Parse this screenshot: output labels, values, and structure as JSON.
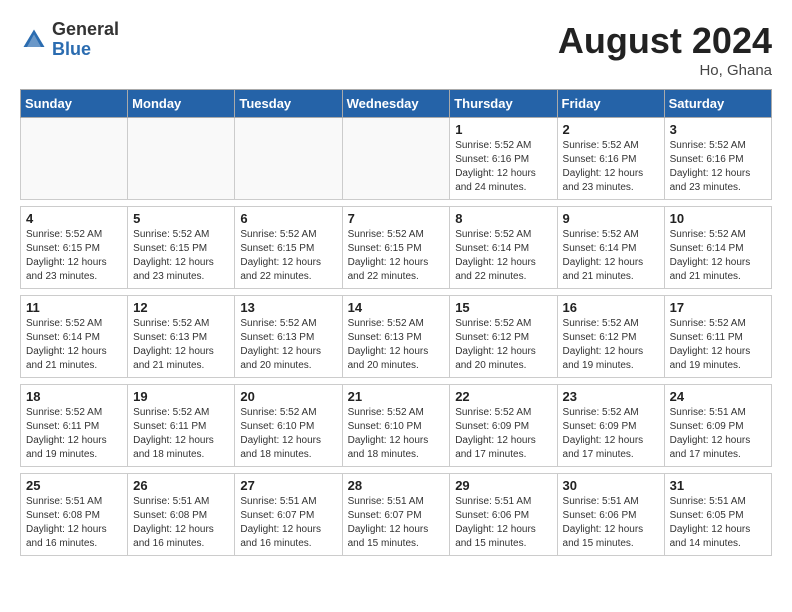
{
  "logo": {
    "general": "General",
    "blue": "Blue"
  },
  "title": {
    "month_year": "August 2024",
    "location": "Ho, Ghana"
  },
  "headers": [
    "Sunday",
    "Monday",
    "Tuesday",
    "Wednesday",
    "Thursday",
    "Friday",
    "Saturday"
  ],
  "weeks": [
    [
      {
        "day": "",
        "info": ""
      },
      {
        "day": "",
        "info": ""
      },
      {
        "day": "",
        "info": ""
      },
      {
        "day": "",
        "info": ""
      },
      {
        "day": "1",
        "info": "Sunrise: 5:52 AM\nSunset: 6:16 PM\nDaylight: 12 hours\nand 24 minutes."
      },
      {
        "day": "2",
        "info": "Sunrise: 5:52 AM\nSunset: 6:16 PM\nDaylight: 12 hours\nand 23 minutes."
      },
      {
        "day": "3",
        "info": "Sunrise: 5:52 AM\nSunset: 6:16 PM\nDaylight: 12 hours\nand 23 minutes."
      }
    ],
    [
      {
        "day": "4",
        "info": "Sunrise: 5:52 AM\nSunset: 6:15 PM\nDaylight: 12 hours\nand 23 minutes."
      },
      {
        "day": "5",
        "info": "Sunrise: 5:52 AM\nSunset: 6:15 PM\nDaylight: 12 hours\nand 23 minutes."
      },
      {
        "day": "6",
        "info": "Sunrise: 5:52 AM\nSunset: 6:15 PM\nDaylight: 12 hours\nand 22 minutes."
      },
      {
        "day": "7",
        "info": "Sunrise: 5:52 AM\nSunset: 6:15 PM\nDaylight: 12 hours\nand 22 minutes."
      },
      {
        "day": "8",
        "info": "Sunrise: 5:52 AM\nSunset: 6:14 PM\nDaylight: 12 hours\nand 22 minutes."
      },
      {
        "day": "9",
        "info": "Sunrise: 5:52 AM\nSunset: 6:14 PM\nDaylight: 12 hours\nand 21 minutes."
      },
      {
        "day": "10",
        "info": "Sunrise: 5:52 AM\nSunset: 6:14 PM\nDaylight: 12 hours\nand 21 minutes."
      }
    ],
    [
      {
        "day": "11",
        "info": "Sunrise: 5:52 AM\nSunset: 6:14 PM\nDaylight: 12 hours\nand 21 minutes."
      },
      {
        "day": "12",
        "info": "Sunrise: 5:52 AM\nSunset: 6:13 PM\nDaylight: 12 hours\nand 21 minutes."
      },
      {
        "day": "13",
        "info": "Sunrise: 5:52 AM\nSunset: 6:13 PM\nDaylight: 12 hours\nand 20 minutes."
      },
      {
        "day": "14",
        "info": "Sunrise: 5:52 AM\nSunset: 6:13 PM\nDaylight: 12 hours\nand 20 minutes."
      },
      {
        "day": "15",
        "info": "Sunrise: 5:52 AM\nSunset: 6:12 PM\nDaylight: 12 hours\nand 20 minutes."
      },
      {
        "day": "16",
        "info": "Sunrise: 5:52 AM\nSunset: 6:12 PM\nDaylight: 12 hours\nand 19 minutes."
      },
      {
        "day": "17",
        "info": "Sunrise: 5:52 AM\nSunset: 6:11 PM\nDaylight: 12 hours\nand 19 minutes."
      }
    ],
    [
      {
        "day": "18",
        "info": "Sunrise: 5:52 AM\nSunset: 6:11 PM\nDaylight: 12 hours\nand 19 minutes."
      },
      {
        "day": "19",
        "info": "Sunrise: 5:52 AM\nSunset: 6:11 PM\nDaylight: 12 hours\nand 18 minutes."
      },
      {
        "day": "20",
        "info": "Sunrise: 5:52 AM\nSunset: 6:10 PM\nDaylight: 12 hours\nand 18 minutes."
      },
      {
        "day": "21",
        "info": "Sunrise: 5:52 AM\nSunset: 6:10 PM\nDaylight: 12 hours\nand 18 minutes."
      },
      {
        "day": "22",
        "info": "Sunrise: 5:52 AM\nSunset: 6:09 PM\nDaylight: 12 hours\nand 17 minutes."
      },
      {
        "day": "23",
        "info": "Sunrise: 5:52 AM\nSunset: 6:09 PM\nDaylight: 12 hours\nand 17 minutes."
      },
      {
        "day": "24",
        "info": "Sunrise: 5:51 AM\nSunset: 6:09 PM\nDaylight: 12 hours\nand 17 minutes."
      }
    ],
    [
      {
        "day": "25",
        "info": "Sunrise: 5:51 AM\nSunset: 6:08 PM\nDaylight: 12 hours\nand 16 minutes."
      },
      {
        "day": "26",
        "info": "Sunrise: 5:51 AM\nSunset: 6:08 PM\nDaylight: 12 hours\nand 16 minutes."
      },
      {
        "day": "27",
        "info": "Sunrise: 5:51 AM\nSunset: 6:07 PM\nDaylight: 12 hours\nand 16 minutes."
      },
      {
        "day": "28",
        "info": "Sunrise: 5:51 AM\nSunset: 6:07 PM\nDaylight: 12 hours\nand 15 minutes."
      },
      {
        "day": "29",
        "info": "Sunrise: 5:51 AM\nSunset: 6:06 PM\nDaylight: 12 hours\nand 15 minutes."
      },
      {
        "day": "30",
        "info": "Sunrise: 5:51 AM\nSunset: 6:06 PM\nDaylight: 12 hours\nand 15 minutes."
      },
      {
        "day": "31",
        "info": "Sunrise: 5:51 AM\nSunset: 6:05 PM\nDaylight: 12 hours\nand 14 minutes."
      }
    ]
  ]
}
